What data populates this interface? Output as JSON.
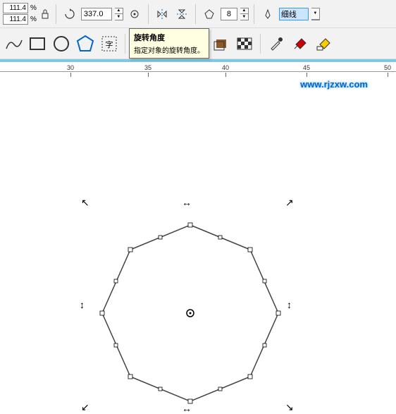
{
  "toolbar": {
    "scale_x": "111.4",
    "scale_y": "111.4",
    "percent": "%",
    "rotation": "337.0",
    "sides": "8",
    "outline": "细线"
  },
  "tooltip": {
    "title": "旋转角度",
    "desc": "指定对象的旋转角度。"
  },
  "ruler": {
    "t30": "30",
    "t35": "35",
    "t40": "40",
    "t45": "45",
    "t50": "50"
  },
  "watermark": "www.rjzxw.com"
}
